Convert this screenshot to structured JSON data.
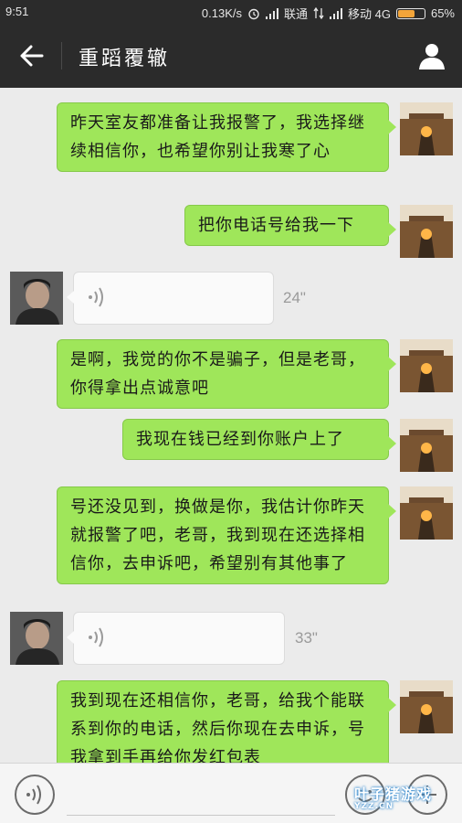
{
  "status_bar": {
    "time": "9:51",
    "network_speed": "0.13K/s",
    "carrier1": "联通",
    "carrier2": "移动 4G",
    "battery_percent": 65,
    "battery_text": "65%",
    "alarm_icon": "alarm-clock-icon"
  },
  "header": {
    "title": "重蹈覆辙",
    "back_icon": "arrow-left-icon",
    "profile_icon": "person-icon"
  },
  "messages": [
    {
      "side": "right",
      "type": "text",
      "text": "昨天室友都准备让我报警了，我选择继续相信你，也希望你别让我寒了心"
    },
    {
      "side": "right",
      "type": "text",
      "text": "把你电话号给我一下"
    },
    {
      "side": "left",
      "type": "voice",
      "duration": "24\""
    },
    {
      "side": "right",
      "type": "text",
      "text": "是啊，我觉的你不是骗子，但是老哥，你得拿出点诚意吧"
    },
    {
      "side": "right",
      "type": "text",
      "text": "我现在钱已经到你账户上了"
    },
    {
      "side": "right",
      "type": "text",
      "text": "号还没见到，换做是你，我估计你昨天就报警了吧，老哥，我到现在还选择相信你，去申诉吧，希望别有其他事了"
    },
    {
      "side": "left",
      "type": "voice",
      "duration": "33\""
    },
    {
      "side": "right",
      "type": "text",
      "text": "我到现在还相信你，老哥，给我个能联系到你的电话，然后你现在去申诉，号我拿到手再给你发红包表"
    }
  ],
  "input_bar": {
    "voice_icon": "voice-wave-icon",
    "emoji_icon": "smiley-icon",
    "plus_icon": "plus-icon",
    "input_value": ""
  },
  "watermark": {
    "text": "叶子猪游戏",
    "url": "YZZ.CN"
  },
  "colors": {
    "bubble_out": "#9fe65a",
    "bubble_in": "#fafafa",
    "header_bg": "#2b2b2b",
    "chat_bg": "#ebebeb",
    "battery": "#f3a53a"
  }
}
